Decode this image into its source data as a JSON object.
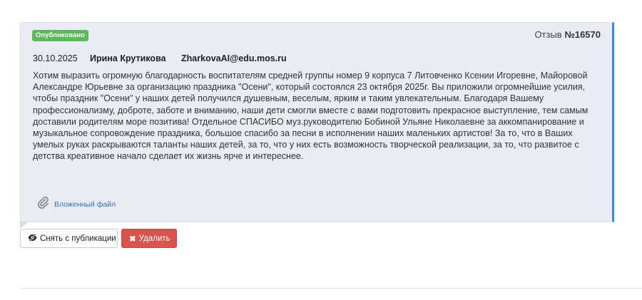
{
  "review": {
    "status_badge": "Опубликовано",
    "number_label": "Отзыв",
    "number": "№16570",
    "date": "30.10.2025",
    "author": "Ирина Крутикова",
    "email": "ZharkovaAI@edu.mos.ru",
    "text": "Хотим выразить огромную благодарность воспитателям средней группы номер 9 корпуса 7 Литовченко Ксении Игоревне, Майоровой Александре Юрьевне за организацию праздника \"Осени\", который состоялся 23 октября 2025г. Вы приложили огромнейшие усилия, чтобы праздник \"Осени\" у наших детей получился душевным, веселым, ярким и таким увлекательным. Благодаря Вашему профессионализму, доброте, заботе и вниманию, наши дети смогли вместе с вами подготовить прекрасное выступление, тем самым доставили родителям море позитива! Отдельное СПАСИБО муз.руководителю Бобиной Ульяне Николаевне за аккомпанирование и музыкальное сопровождение праздника, большое спасибо за песни в исполнении наших маленьких артистов! За то, что в Ваших умелых руках раскрываются таланты наших детей, за то, что у них есть возможность творческой реализации, за то, что развитое с детства креативное начало сделает их жизнь ярче и интереснее.",
    "attachment_label": "Вложенный файл",
    "attachment_icon": "paperclip-icon"
  },
  "actions": {
    "unpublish_label": "Снять с публикации",
    "unpublish_icon": "eye-slash-icon",
    "delete_label": "Удалить",
    "delete_icon": "close-icon"
  },
  "colors": {
    "badge": "#5cb85c",
    "card_bg": "#e9ecf2",
    "accent_border": "#4a86d1",
    "delete_button": "#d9534f",
    "link": "#3a6fb5"
  }
}
